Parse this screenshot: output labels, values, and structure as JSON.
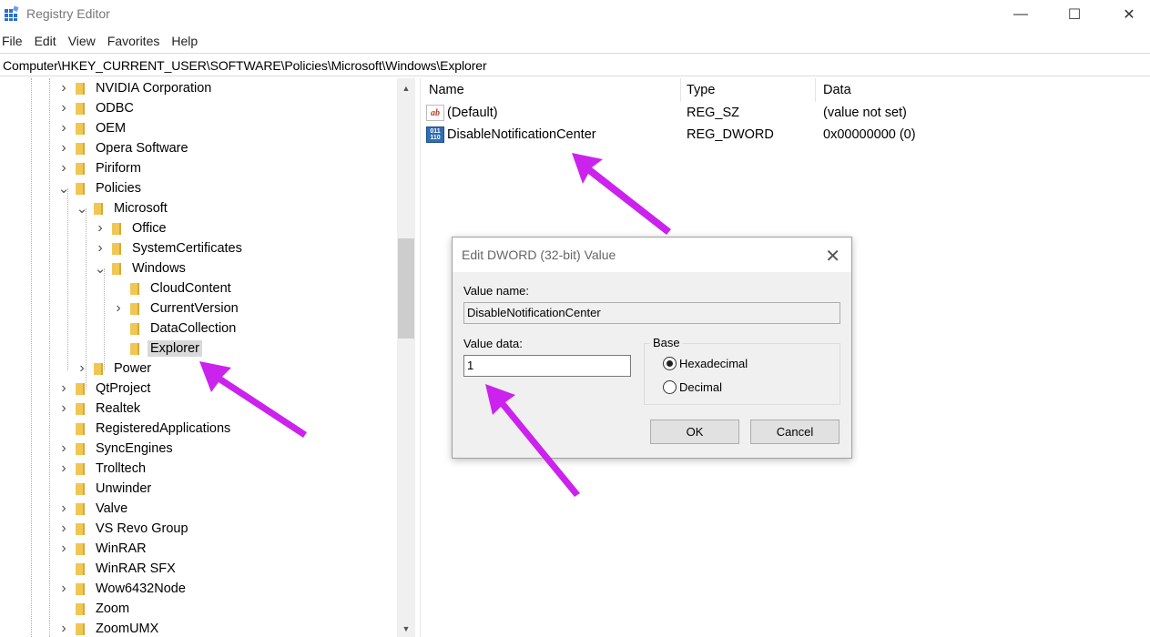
{
  "window": {
    "title": "Registry Editor",
    "controls": {
      "minimize": "—",
      "maximize": "☐",
      "close": "✕"
    }
  },
  "menu": [
    "File",
    "Edit",
    "View",
    "Favorites",
    "Help"
  ],
  "address": "Computer\\HKEY_CURRENT_USER\\SOFTWARE\\Policies\\Microsoft\\Windows\\Explorer",
  "tree": {
    "items": [
      {
        "label": "NVIDIA Corporation",
        "level": 0,
        "expander": ">"
      },
      {
        "label": "ODBC",
        "level": 0,
        "expander": ">"
      },
      {
        "label": "OEM",
        "level": 0,
        "expander": ">"
      },
      {
        "label": "Opera Software",
        "level": 0,
        "expander": ">"
      },
      {
        "label": "Piriform",
        "level": 0,
        "expander": ">"
      },
      {
        "label": "Policies",
        "level": 0,
        "expander": "v"
      },
      {
        "label": "Microsoft",
        "level": 1,
        "expander": "v"
      },
      {
        "label": "Office",
        "level": 2,
        "expander": ">"
      },
      {
        "label": "SystemCertificates",
        "level": 2,
        "expander": ">"
      },
      {
        "label": "Windows",
        "level": 2,
        "expander": "v"
      },
      {
        "label": "CloudContent",
        "level": 3,
        "expander": ""
      },
      {
        "label": "CurrentVersion",
        "level": 3,
        "expander": ">"
      },
      {
        "label": "DataCollection",
        "level": 3,
        "expander": ""
      },
      {
        "label": "Explorer",
        "level": 3,
        "expander": "",
        "selected": true
      },
      {
        "label": "Power",
        "level": 1,
        "expander": ">"
      },
      {
        "label": "QtProject",
        "level": 0,
        "expander": ">"
      },
      {
        "label": "Realtek",
        "level": 0,
        "expander": ">"
      },
      {
        "label": "RegisteredApplications",
        "level": 0,
        "expander": ""
      },
      {
        "label": "SyncEngines",
        "level": 0,
        "expander": ">"
      },
      {
        "label": "Trolltech",
        "level": 0,
        "expander": ">"
      },
      {
        "label": "Unwinder",
        "level": 0,
        "expander": ""
      },
      {
        "label": "Valve",
        "level": 0,
        "expander": ">"
      },
      {
        "label": "VS Revo Group",
        "level": 0,
        "expander": ">"
      },
      {
        "label": "WinRAR",
        "level": 0,
        "expander": ">"
      },
      {
        "label": "WinRAR SFX",
        "level": 0,
        "expander": ""
      },
      {
        "label": "Wow6432Node",
        "level": 0,
        "expander": ">"
      },
      {
        "label": "Zoom",
        "level": 0,
        "expander": ""
      },
      {
        "label": "ZoomUMX",
        "level": 0,
        "expander": ">"
      }
    ]
  },
  "list": {
    "columns": [
      "Name",
      "Type",
      "Data"
    ],
    "rows": [
      {
        "icon": "ab",
        "name": "(Default)",
        "type": "REG_SZ",
        "data": "(value not set)"
      },
      {
        "icon": "011 110",
        "name": "DisableNotificationCenter",
        "type": "REG_DWORD",
        "data": "0x00000000 (0)"
      }
    ]
  },
  "dialog": {
    "title": "Edit DWORD (32-bit) Value",
    "value_name_label": "Value name:",
    "value_name": "DisableNotificationCenter",
    "value_data_label": "Value data:",
    "value_data": "1",
    "base_label": "Base",
    "radio_hex": "Hexadecimal",
    "radio_dec": "Decimal",
    "selected_base": "Hexadecimal",
    "ok": "OK",
    "cancel": "Cancel"
  },
  "colors": {
    "annotation_arrow": "#cc22ee",
    "folder": "#f0c755",
    "selection": "#d9d9d9"
  },
  "icons": [
    "regedit-icon",
    "folder-icon",
    "chevron-right-icon",
    "chevron-down-icon",
    "string-value-icon",
    "binary-value-icon",
    "close-icon",
    "arrow-annotation"
  ]
}
